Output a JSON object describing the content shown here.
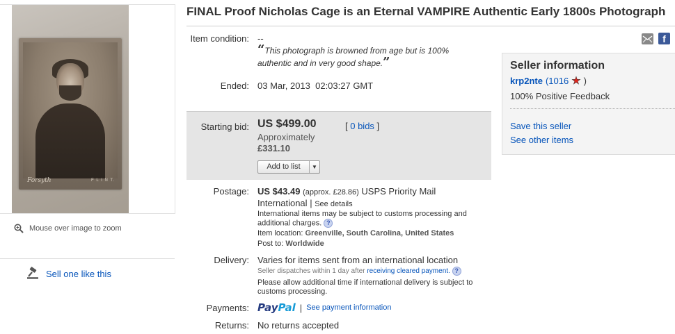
{
  "listing": {
    "title": "FINAL Proof Nicholas Cage is an Eternal VAMPIRE Authentic Early 1800s Photograph",
    "photo_signature": "Forsyth",
    "photo_place": "F L I N T."
  },
  "gallery": {
    "zoom_hint": "Mouse over image to zoom",
    "sell_link": "Sell one like this"
  },
  "details": {
    "condition_label": "Item condition:",
    "condition_value": "--",
    "condition_note": "This photograph is browned from age but is 100% authentic and in very good shape.",
    "ended_label": "Ended:",
    "ended_value": "03 Mar, 2013  02:03:27 GMT",
    "bid_label": "Starting bid:",
    "bid_price": "US $499.00",
    "bid_approx_label": "Approximately",
    "bid_approx_value": "£331.10",
    "bids_link": "0 bids",
    "add_to_list": "Add to list",
    "postage_label": "Postage:",
    "postage_price": "US $43.49",
    "postage_approx": "(approx. £28.86)",
    "postage_service": "USPS Priority Mail International",
    "postage_details_link": "See details",
    "postage_note": "International items may be subject to customs processing and additional charges.",
    "item_location_label": "Item location:",
    "item_location": "Greenville, South Carolina, United States",
    "post_to_label": "Post to:",
    "post_to": "Worldwide",
    "delivery_label": "Delivery:",
    "delivery_value": "Varies for items sent from an international location",
    "dispatch_text": "Seller dispatches within 1 day after",
    "dispatch_link": "receiving cleared payment.",
    "delivery_note": "Please allow additional time if international delivery is subject to customs processing.",
    "payments_label": "Payments:",
    "paypal_pay": "Pay",
    "paypal_pal": "Pal",
    "payment_info_link": "See payment information",
    "returns_label": "Returns:",
    "returns_value": "No returns accepted"
  },
  "seller": {
    "heading": "Seller information",
    "name": "krp2nte",
    "score": "(1016",
    "score_close": ")",
    "feedback": "100% Positive Feedback",
    "save_link": "Save this seller",
    "other_link": "See other items"
  },
  "share": {
    "fb_glyph": "f"
  },
  "colors": {
    "link": "#0654ba",
    "bid_box": "#e5e5e5",
    "seller_box": "#f4f4f4"
  }
}
